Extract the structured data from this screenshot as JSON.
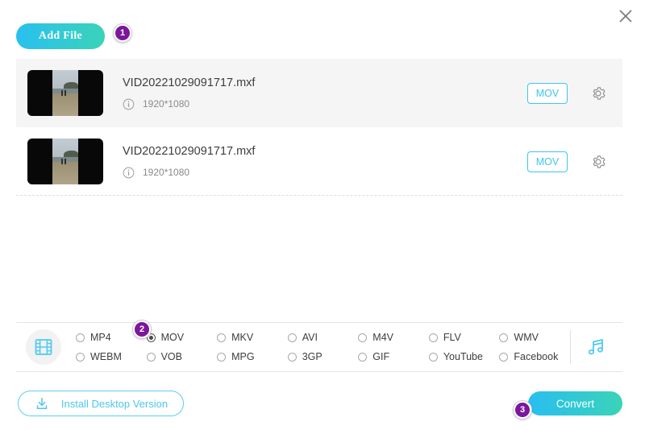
{
  "window": {
    "close_label": "×"
  },
  "toolbar": {
    "add_file_label": "Add File",
    "badge_1": "1"
  },
  "files": {
    "rows": [
      {
        "name": "VID20221029091717.mxf",
        "resolution": "1920*1080",
        "format_label": "MOV"
      },
      {
        "name": "VID20221029091717.mxf",
        "resolution": "1920*1080",
        "format_label": "MOV"
      }
    ]
  },
  "format_panel": {
    "badge_2": "2",
    "selected": "MOV",
    "options": [
      "MP4",
      "MOV",
      "MKV",
      "AVI",
      "M4V",
      "FLV",
      "WMV",
      "WEBM",
      "VOB",
      "MPG",
      "3GP",
      "GIF",
      "YouTube",
      "Facebook"
    ]
  },
  "footer": {
    "install_label": "Install Desktop Version",
    "convert_label": "Convert",
    "badge_3": "3"
  },
  "colors": {
    "accent_cyan": "#3dc6f0",
    "accent_teal": "#3ad3b8",
    "badge_purple": "#7b179c"
  }
}
